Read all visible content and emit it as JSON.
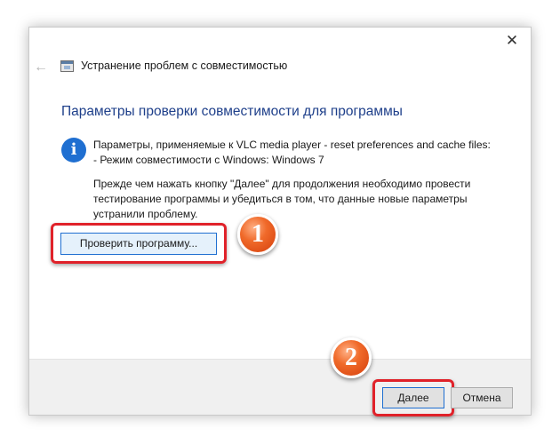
{
  "dialog": {
    "window_title": "Устранение проблем с совместимостью",
    "heading": "Параметры проверки совместимости для программы",
    "info_lines": [
      "Параметры, применяемые к VLC media player - reset preferences and cache files:",
      "- Режим совместимости с Windows: Windows 7"
    ],
    "description_lines": [
      "Прежде чем нажать кнопку \"Далее\" для продолжения необходимо провести",
      "тестирование программы и убедиться в том, что данные новые параметры",
      "устранили проблему."
    ],
    "test_button_label": "Проверить программу...",
    "next_label": "Далее",
    "cancel_label": "Отмена",
    "close_glyph": "✕",
    "back_glyph": "←",
    "info_glyph": "i"
  },
  "annotations": {
    "step1": "1",
    "step2": "2",
    "highlight_color": "#e0222a",
    "badge_color": "#f06a2a"
  },
  "icons": {
    "back": "back-arrow-icon",
    "app": "compatibility-troubleshooter-icon",
    "info": "info-icon",
    "close": "close-icon"
  }
}
